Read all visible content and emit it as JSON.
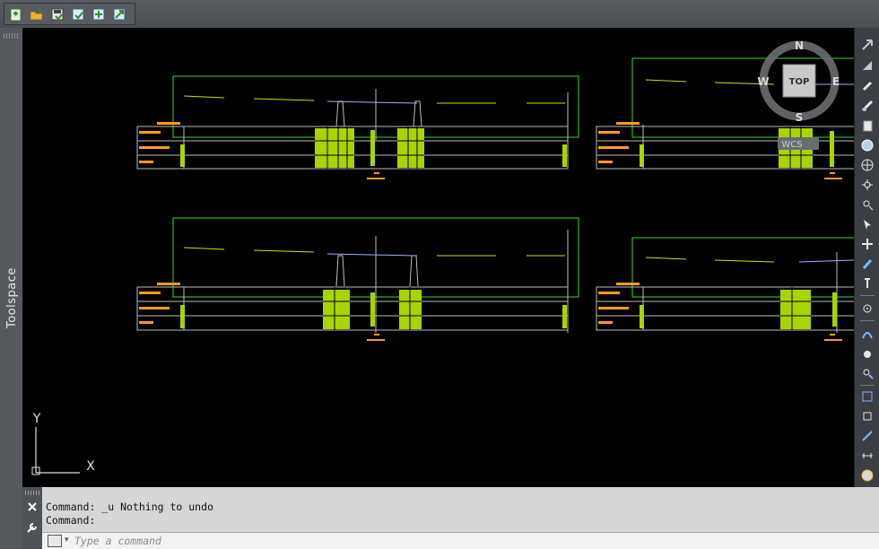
{
  "quick_access": {
    "buttons": [
      {
        "name": "qa-new-icon"
      },
      {
        "name": "qa-open-icon"
      },
      {
        "name": "qa-save-icon"
      },
      {
        "name": "qa-saveas-icon"
      },
      {
        "name": "qa-publish-icon"
      },
      {
        "name": "qa-export-icon"
      }
    ]
  },
  "toolspace": {
    "label": "Toolspace"
  },
  "viewcube": {
    "north": "N",
    "south": "S",
    "east": "E",
    "west": "W",
    "face": "TOP",
    "wcs": "WCS"
  },
  "ucs": {
    "x_label": "X",
    "y_label": "Y"
  },
  "command": {
    "history": [
      "Command: _u Nothing to undo",
      "Command:"
    ],
    "placeholder": "Type a command"
  },
  "colors": {
    "model_bg": "#000000",
    "grid_line": "#bdbdbd",
    "frame_green": "#2fb52f",
    "profile_yellow": "#cfe000",
    "label_orange": "#ff9a1e",
    "block_fill": "#a8d400"
  }
}
